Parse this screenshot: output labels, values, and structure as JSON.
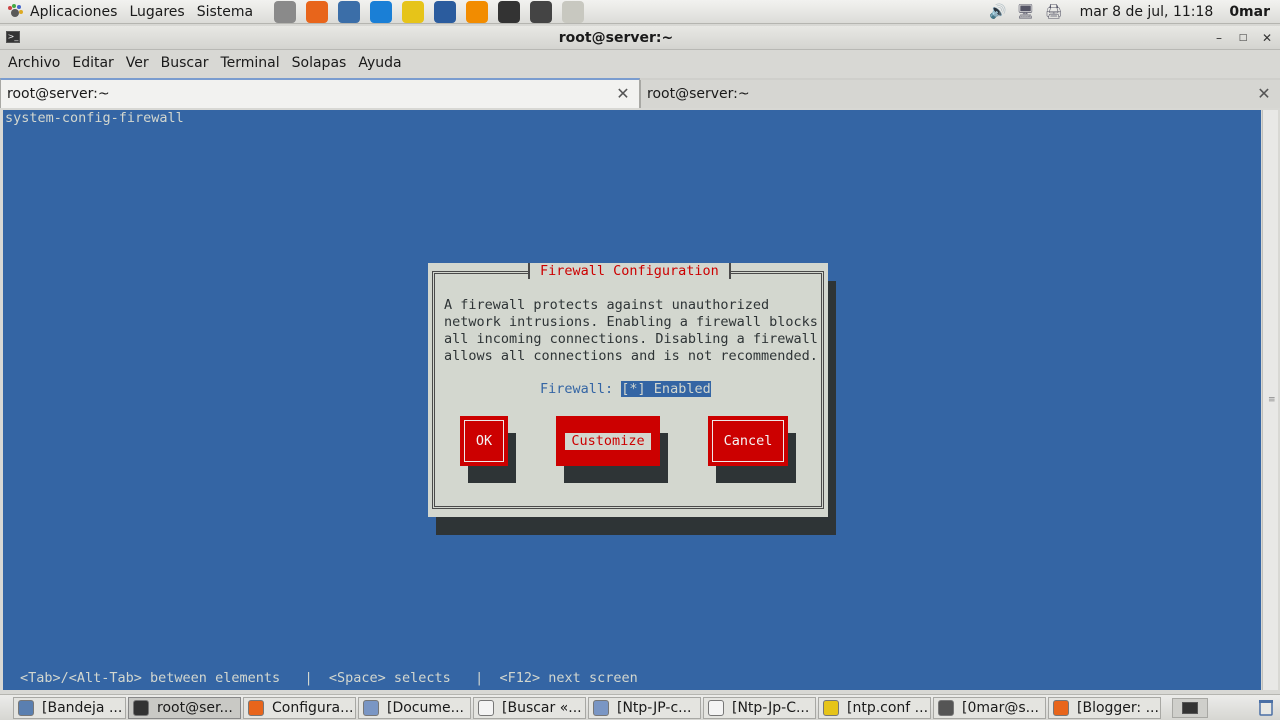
{
  "top_panel": {
    "menus": [
      "Aplicaciones",
      "Lugares",
      "Sistema"
    ],
    "launchers": [
      {
        "icon": "help-icon",
        "color": "#8a8a8a"
      },
      {
        "icon": "firefox-icon",
        "color": "#e8651b"
      },
      {
        "icon": "thunderbird-icon",
        "color": "#3b6ea8"
      },
      {
        "icon": "teamviewer-icon",
        "color": "#1a7fd6"
      },
      {
        "icon": "notes-icon",
        "color": "#e6c419"
      },
      {
        "icon": "virtualbox-icon",
        "color": "#2b5c9e"
      },
      {
        "icon": "vlc-icon",
        "color": "#f28c00"
      },
      {
        "icon": "terminal-icon",
        "color": "#333333"
      },
      {
        "icon": "calculator-icon",
        "color": "#444444"
      },
      {
        "icon": "text-editor-icon",
        "color": "#c8c8c0"
      }
    ],
    "clock": "mar  8 de jul, 11:18",
    "user": "0mar"
  },
  "window": {
    "title": "root@server:~",
    "menu": [
      "Archivo",
      "Editar",
      "Ver",
      "Buscar",
      "Terminal",
      "Solapas",
      "Ayuda"
    ],
    "tabs": [
      {
        "label": "root@server:~",
        "active": true
      },
      {
        "label": "root@server:~",
        "active": false
      }
    ]
  },
  "terminal": {
    "command": "system-config-firewall",
    "hint": "<Tab>/<Alt-Tab> between elements   |  <Space> selects   |  <F12> next screen"
  },
  "dialog": {
    "title": "Firewall Configuration",
    "lines": [
      "A firewall protects against unauthorized",
      "network intrusions. Enabling a firewall blocks",
      "all incoming connections. Disabling a firewall",
      "allows all connections and is not recommended."
    ],
    "firewall_label": "Firewall:",
    "firewall_value": "[*] Enabled",
    "buttons": {
      "ok": "OK",
      "customize": "Customize",
      "cancel": "Cancel"
    }
  },
  "taskbar": {
    "tasks": [
      {
        "label": "[Bandeja ...",
        "icon": "mail-icon",
        "color": "#5a7fb0",
        "active": false
      },
      {
        "label": "root@ser...",
        "icon": "terminal-icon",
        "color": "#333333",
        "active": true
      },
      {
        "label": "Configura...",
        "icon": "firefox-icon",
        "color": "#e8651b",
        "active": false
      },
      {
        "label": "[Docume...",
        "icon": "folder-icon",
        "color": "#7a96c4",
        "active": false
      },
      {
        "label": "[Buscar «...",
        "icon": "document-icon",
        "color": "#f4f4f4",
        "active": false
      },
      {
        "label": "[Ntp-JP-c...",
        "icon": "folder-icon",
        "color": "#7a96c4",
        "active": false
      },
      {
        "label": "[Ntp-Jp-C...",
        "icon": "document-icon",
        "color": "#f4f4f4",
        "active": false
      },
      {
        "label": "[ntp.conf ...",
        "icon": "text-editor-icon",
        "color": "#e6c419",
        "active": false
      },
      {
        "label": "[0mar@s...",
        "icon": "terminal-icon",
        "color": "#555555",
        "active": false
      },
      {
        "label": "[Blogger: ...",
        "icon": "firefox-icon",
        "color": "#e8651b",
        "active": false
      }
    ]
  }
}
